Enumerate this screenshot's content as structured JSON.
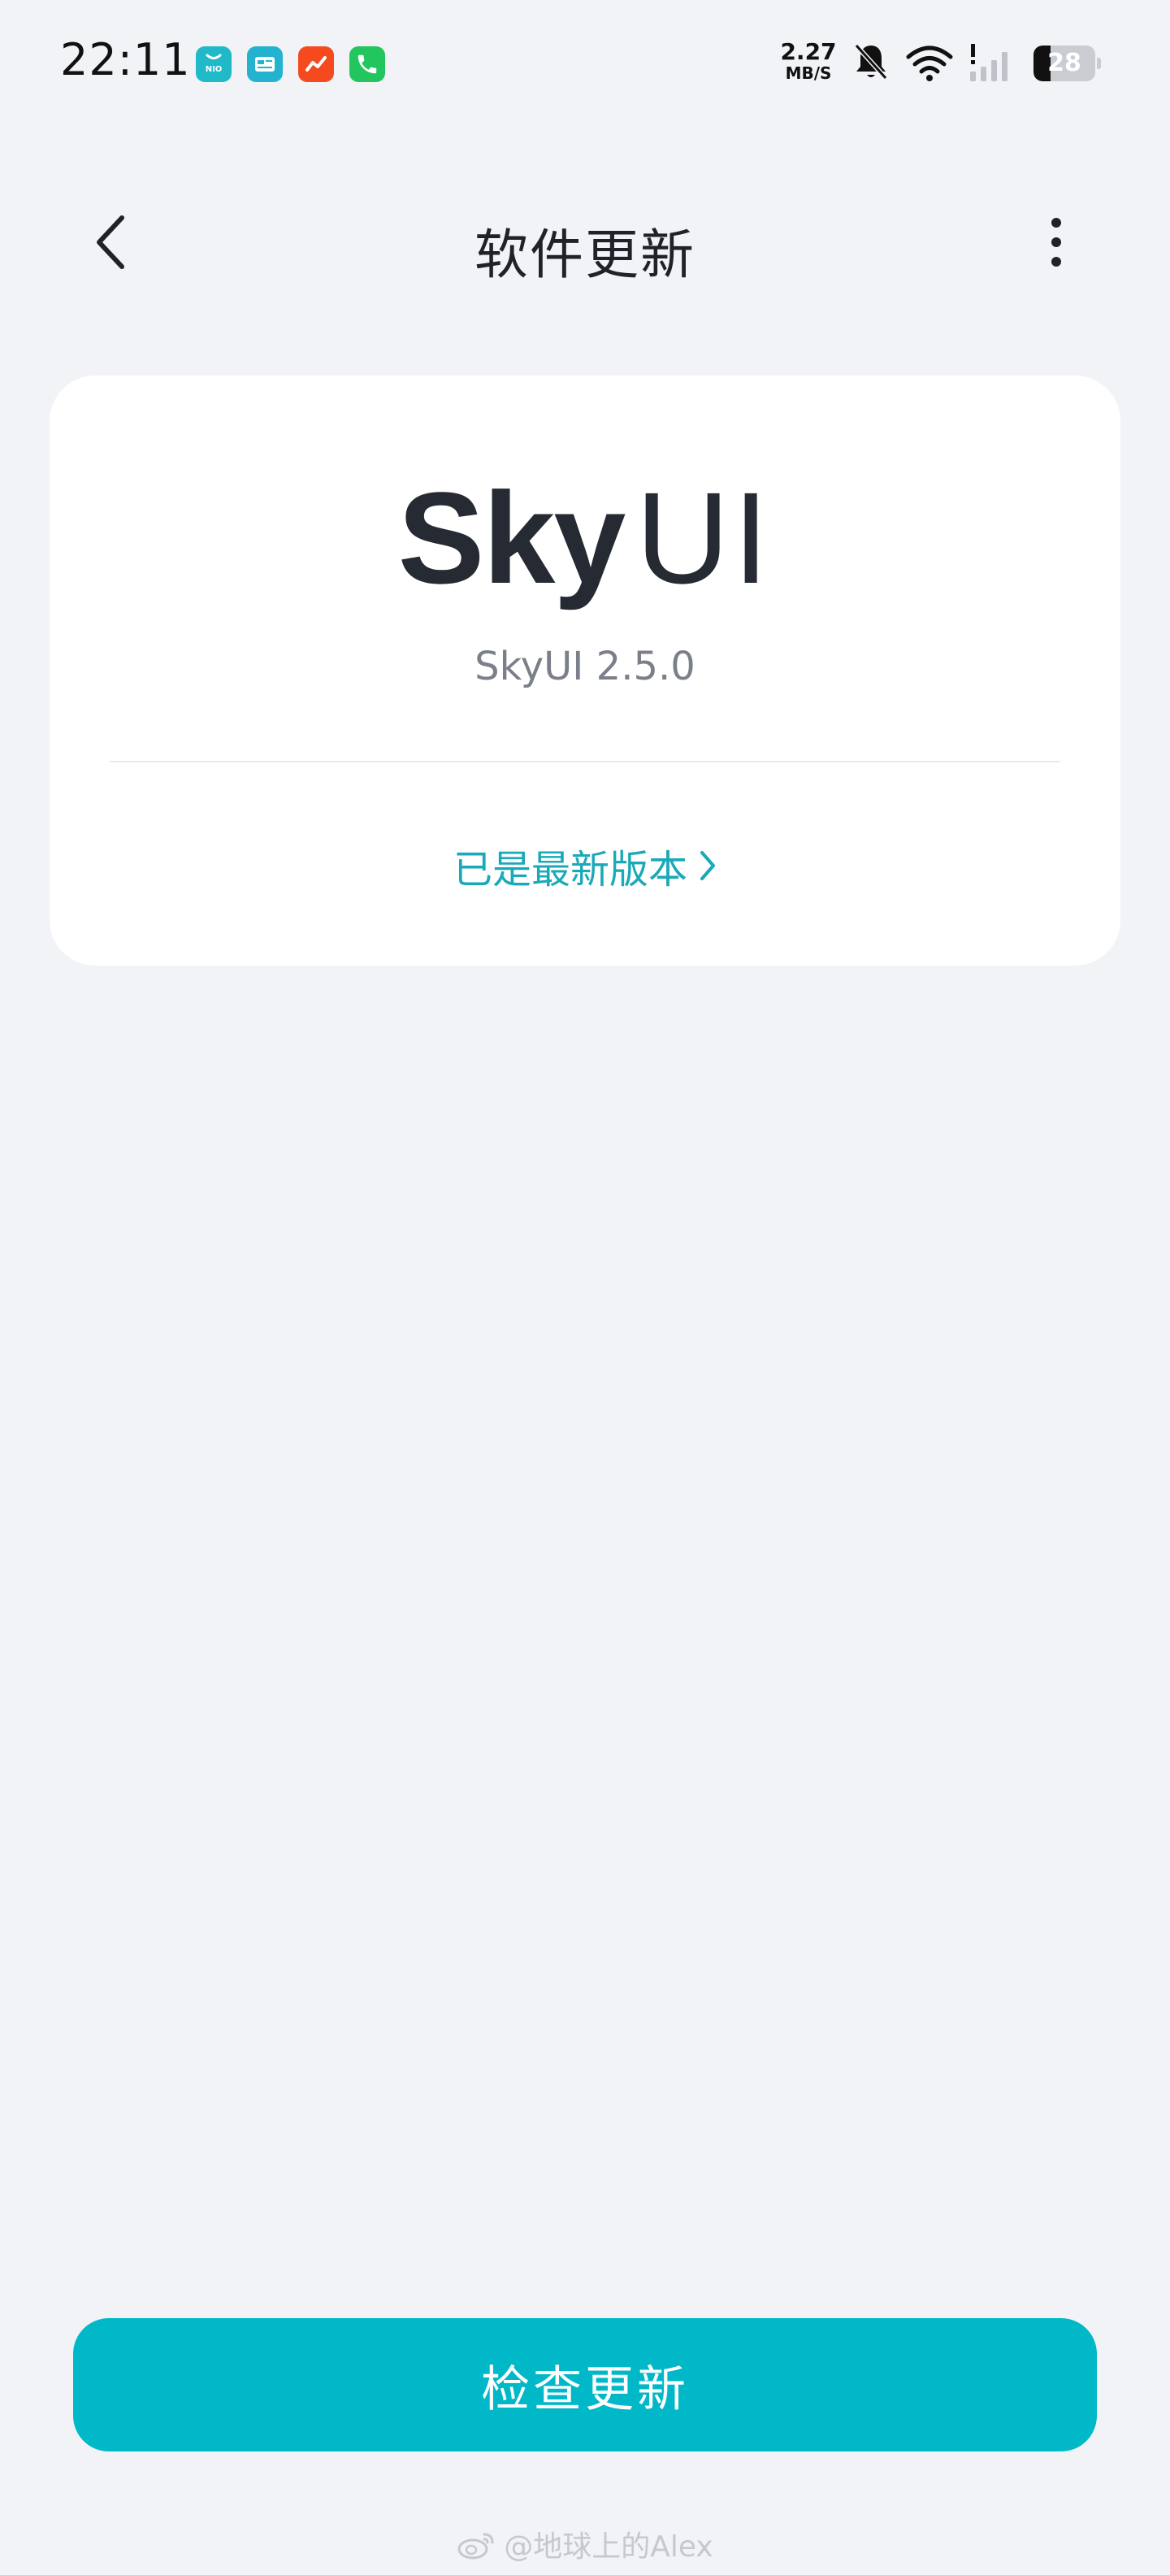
{
  "status_bar": {
    "time": "22:11",
    "net_speed_value": "2.27",
    "net_speed_unit": "MB/S",
    "battery_level": "28",
    "notification_apps": [
      "nio-app-icon",
      "news-app-icon",
      "stocks-app-icon",
      "phone-app-icon"
    ],
    "notification_app_labels": {
      "nio": "NIO"
    },
    "icons": [
      "bell-muted-icon",
      "wifi-icon",
      "signal-icon",
      "battery-icon"
    ],
    "colors": {
      "nio": "#1fb9c9",
      "news": "#23b3cf",
      "stocks": "#f44a1e",
      "phone": "#22c55e"
    }
  },
  "header": {
    "title": "软件更新",
    "back_icon": "chevron-left-icon",
    "more_icon": "more-vertical-icon"
  },
  "card": {
    "logo_sky": "Sky",
    "logo_ui": "UI",
    "version": "SkyUI 2.5.0",
    "status": "已是最新版本",
    "status_chevron_icon": "chevron-right-icon"
  },
  "actions": {
    "check_update_label": "检查更新"
  },
  "watermark": {
    "text": "@地球上的Alex",
    "icon": "weibo-icon"
  },
  "theme": {
    "background": "#f1f3f7",
    "accent": "#00b8c7",
    "link": "#19a9b8"
  }
}
